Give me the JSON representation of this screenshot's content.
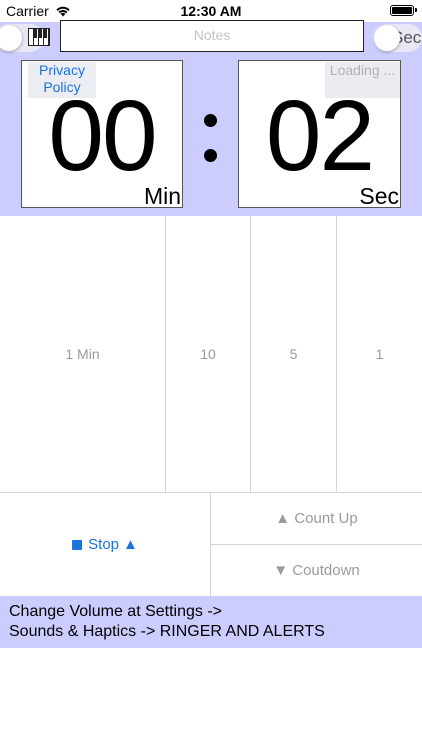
{
  "status_bar": {
    "carrier": "Carrier",
    "time": "12:30 AM",
    "wifi_icon": "wifi-icon",
    "battery_icon": "battery-icon"
  },
  "top": {
    "notes_placeholder": "Notes",
    "right_toggle_label": "Sec",
    "piano_icon": "piano-icon",
    "privacy_policy": "Privacy Policy",
    "loading": "Loading ...",
    "minutes": "00",
    "minutes_unit": "Min",
    "seconds": "02",
    "seconds_unit": "Sec"
  },
  "increments": [
    {
      "label": "1 Min"
    },
    {
      "label": "10"
    },
    {
      "label": "5"
    },
    {
      "label": "1"
    }
  ],
  "controls": {
    "stop_label": "Stop",
    "count_up_label": "Count Up",
    "countdown_label": "Coutdown"
  },
  "info": {
    "line1": "Change Volume at Settings ->",
    "line2": "Sounds & Haptics -> RINGER AND ALERTS"
  },
  "colors": {
    "panel_bg": "#ccccff",
    "accent_blue": "#1a73d9",
    "disabled_gray": "#9a9a9a"
  }
}
